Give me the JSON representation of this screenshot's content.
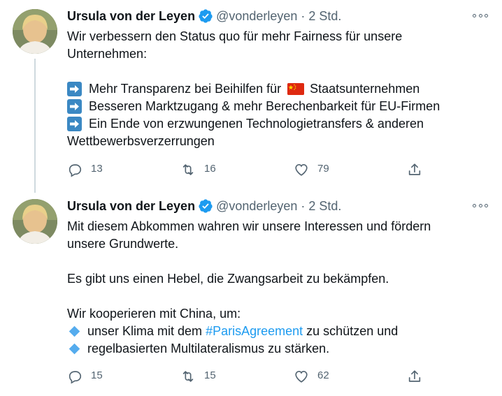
{
  "tweets": [
    {
      "author": {
        "name": "Ursula von der Leyen",
        "handle": "@vonderleyen",
        "verified": true
      },
      "time": "2 Std.",
      "text": {
        "intro_line1": "Wir verbessern den Status quo für mehr Fairness für unsere",
        "intro_line2": "Unternehmen:",
        "bullet1_a": "Mehr Transparenz bei Beihilfen für",
        "bullet1_b": "Staatsunternehmen",
        "bullet2": "Besseren Marktzugang & mehr Berechenbarkeit für EU-Firmen",
        "bullet3_line1": "Ein Ende von erzwungenen Technologietransfers & anderen",
        "bullet3_line2": "Wettbewerbsverzerrungen"
      },
      "icons": {
        "bullet": "arrow-right-emoji",
        "flag": "china-flag-emoji"
      },
      "stats": {
        "replies": "13",
        "retweets": "16",
        "likes": "79"
      }
    },
    {
      "author": {
        "name": "Ursula von der Leyen",
        "handle": "@vonderleyen",
        "verified": true
      },
      "time": "2 Std.",
      "text": {
        "p1_line1": "Mit diesem Abkommen wahren wir unsere Interessen und fördern",
        "p1_line2": "unsere Grundwerte.",
        "p2": "Es gibt uns einen Hebel, die Zwangsarbeit zu bekämpfen.",
        "p3": "Wir kooperieren mit China, um:",
        "bullet1_a": "unser Klima mit dem",
        "bullet1_hashtag": "#ParisAgreement",
        "bullet1_b": "zu schützen und",
        "bullet2": "regelbasierten Multilateralismus zu stärken."
      },
      "icons": {
        "bullet": "blue-diamond-emoji"
      },
      "stats": {
        "replies": "15",
        "retweets": "15",
        "likes": "62"
      }
    }
  ],
  "separator": "·",
  "colors": {
    "text": "#0f1419",
    "secondary": "#536471",
    "link": "#1d9bf0",
    "verified": "#1d9bf0",
    "thread_line": "#cfd9de"
  }
}
